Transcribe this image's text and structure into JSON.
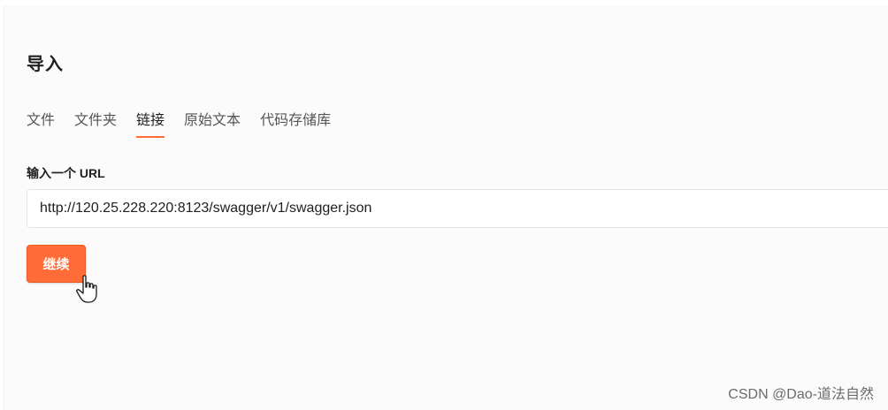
{
  "dialog": {
    "title": "导入"
  },
  "tabs": [
    {
      "label": "文件",
      "active": false
    },
    {
      "label": "文件夹",
      "active": false
    },
    {
      "label": "链接",
      "active": true
    },
    {
      "label": "原始文本",
      "active": false
    },
    {
      "label": "代码存储库",
      "active": false
    }
  ],
  "url_field": {
    "label": "输入一个 URL",
    "value": "http://120.25.228.220:8123/swagger/v1/swagger.json"
  },
  "continue_button": {
    "label": "继续"
  },
  "watermark": {
    "text": "CSDN @Dao-道法自然"
  },
  "colors": {
    "accent": "#ff6c37",
    "text": "#212121"
  }
}
